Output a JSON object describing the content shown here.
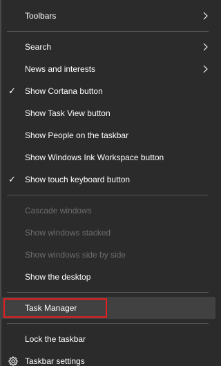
{
  "menu": {
    "toolbars": "Toolbars",
    "search": "Search",
    "news": "News and interests",
    "cortana": "Show Cortana button",
    "task_view": "Show Task View button",
    "people": "Show People on the taskbar",
    "ink": "Show Windows Ink Workspace button",
    "touch_keyboard": "Show touch keyboard button",
    "cascade": "Cascade windows",
    "stacked": "Show windows stacked",
    "side_by_side": "Show windows side by side",
    "desktop": "Show the desktop",
    "task_manager": "Task Manager",
    "lock": "Lock the taskbar",
    "settings": "Taskbar settings"
  },
  "colors": {
    "background": "#2b2b2b",
    "hover": "#414141",
    "disabled_text": "#6d6d6d",
    "highlight_border": "#e02020"
  },
  "icons": {
    "check": "checkmark-icon",
    "submenu": "chevron-right-icon",
    "settings": "gear-icon"
  }
}
